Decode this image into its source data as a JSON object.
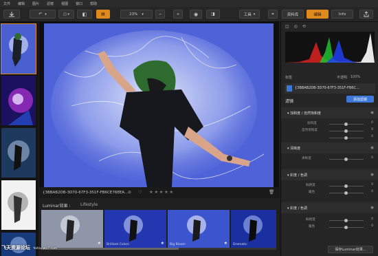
{
  "menu": [
    "文件",
    "编辑",
    "图片",
    "滤镜",
    "视图",
    "窗口",
    "帮助"
  ],
  "toolbar": {
    "zoom": "23%",
    "minus": "−",
    "plus": "+",
    "tool_label": "工具",
    "tabs": [
      "资料库",
      "编辑",
      "Info"
    ]
  },
  "histogram": {
    "label": "标签",
    "opacity_label": "不透明",
    "opacity_value": "100%"
  },
  "image": {
    "filename": "{3BBAB2DB-3D70-67F3-351F-FB6C…",
    "filename_bar": "{3BBAB2DB-3D70-67F3-351F-FB6CE76EEA…"
  },
  "filters": {
    "title": "滤镜",
    "add_button": "添加滤镜",
    "sections": [
      {
        "title": "▾ 加和度 / 自然饱和度",
        "sliders": [
          {
            "label": "加和度",
            "value": "0"
          },
          {
            "label": "自然饱和度",
            "value": "0"
          },
          {
            "label": "",
            "value": "0"
          }
        ]
      },
      {
        "title": "▾ 清晰度",
        "sliders": [
          {
            "label": "清晰度",
            "value": "0"
          }
        ]
      },
      {
        "title": "▾ 彩度 / 色调",
        "sliders": [
          {
            "label": "鲜艳度",
            "value": "0"
          },
          {
            "label": "暖色",
            "value": "0"
          }
        ]
      },
      {
        "title": "▾ 彩度 / 色调",
        "sliders": [
          {
            "label": "鲜艳度",
            "value": "0"
          },
          {
            "label": "暖色",
            "value": "0"
          }
        ]
      }
    ],
    "save_button": "保存Luminar效果..."
  },
  "looks": {
    "label": "Luminar效果 :",
    "category": "Lifestyle",
    "items": [
      "",
      "Brilliant Colors",
      "Big Bloom",
      "Dramatic"
    ]
  },
  "rating": {
    "stars": 5,
    "filled": 0
  },
  "watermark": {
    "text": "飞天资源论坛",
    "url": "feitianwu7.com"
  }
}
